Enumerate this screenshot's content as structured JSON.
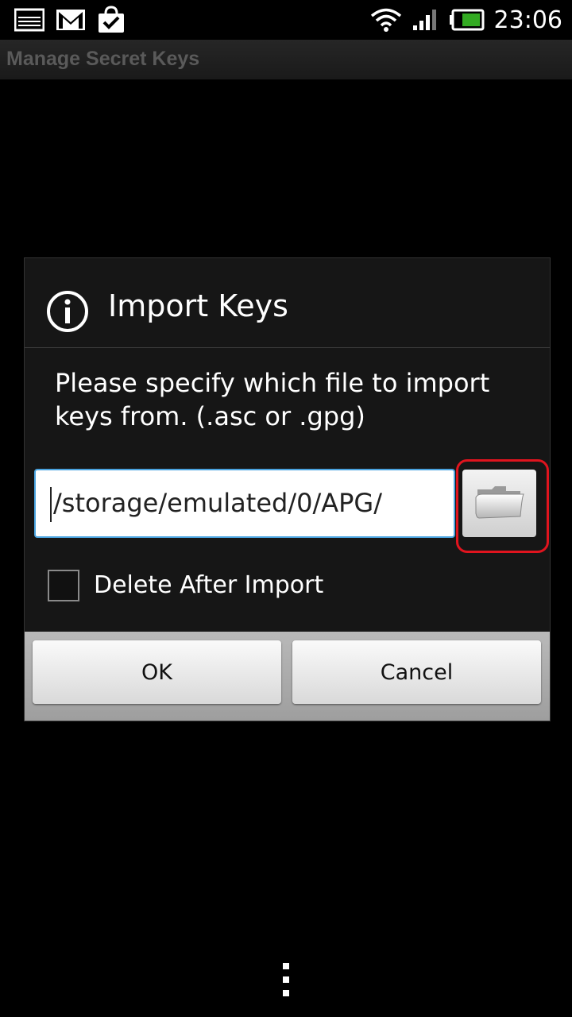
{
  "status_bar": {
    "time": "23:06",
    "icons": [
      "image-notification-icon",
      "gmail-icon",
      "shopping-bag-check-icon",
      "wifi-icon",
      "signal-icon",
      "battery-icon"
    ]
  },
  "app": {
    "title": "Manage Secret Keys"
  },
  "dialog": {
    "title": "Import Keys",
    "icon": "info-icon",
    "message": "Please specify which file to import keys from. (.asc or .gpg)",
    "path_value": "/storage/emulated/0/APG/",
    "browse_icon": "folder-icon",
    "delete_after_import_label": "Delete After Import",
    "delete_after_import_checked": false,
    "ok_label": "OK",
    "cancel_label": "Cancel"
  },
  "colors": {
    "input_border": "#4aa3df",
    "highlight": "#e0141e",
    "battery": "#33aa22"
  },
  "overflow_icon": "overflow-menu-icon"
}
